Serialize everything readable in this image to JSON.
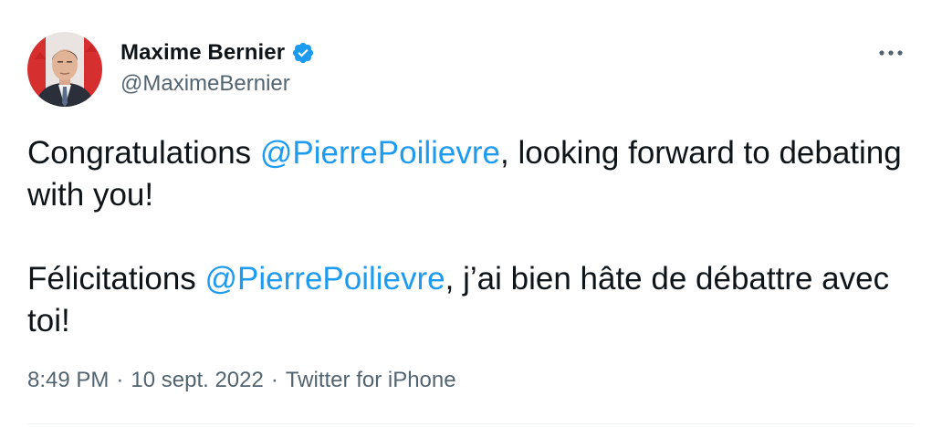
{
  "author": {
    "display_name": "Maxime Bernier",
    "handle": "@MaximeBernier",
    "verified": true,
    "avatar_icon": "profile-photo",
    "verified_icon": "verified-badge-icon"
  },
  "menu": {
    "more_icon": "more-horizontal-icon"
  },
  "tweet": {
    "paragraph_1": {
      "before": "Congratulations ",
      "mention": "@PierrePoilievre",
      "after": ", looking forward to debating with you!"
    },
    "paragraph_2": {
      "before": "Félicitations ",
      "mention": "@PierrePoilievre",
      "after": ", j’ai bien hâte de débattre avec toi!"
    }
  },
  "meta": {
    "time": "8:49 PM",
    "separator": "·",
    "date": "10 sept. 2022",
    "source": "Twitter for iPhone"
  },
  "colors": {
    "link": "#1d9bf0",
    "text": "#0f1419",
    "secondary": "#536471",
    "verified": "#1d9bf0"
  }
}
